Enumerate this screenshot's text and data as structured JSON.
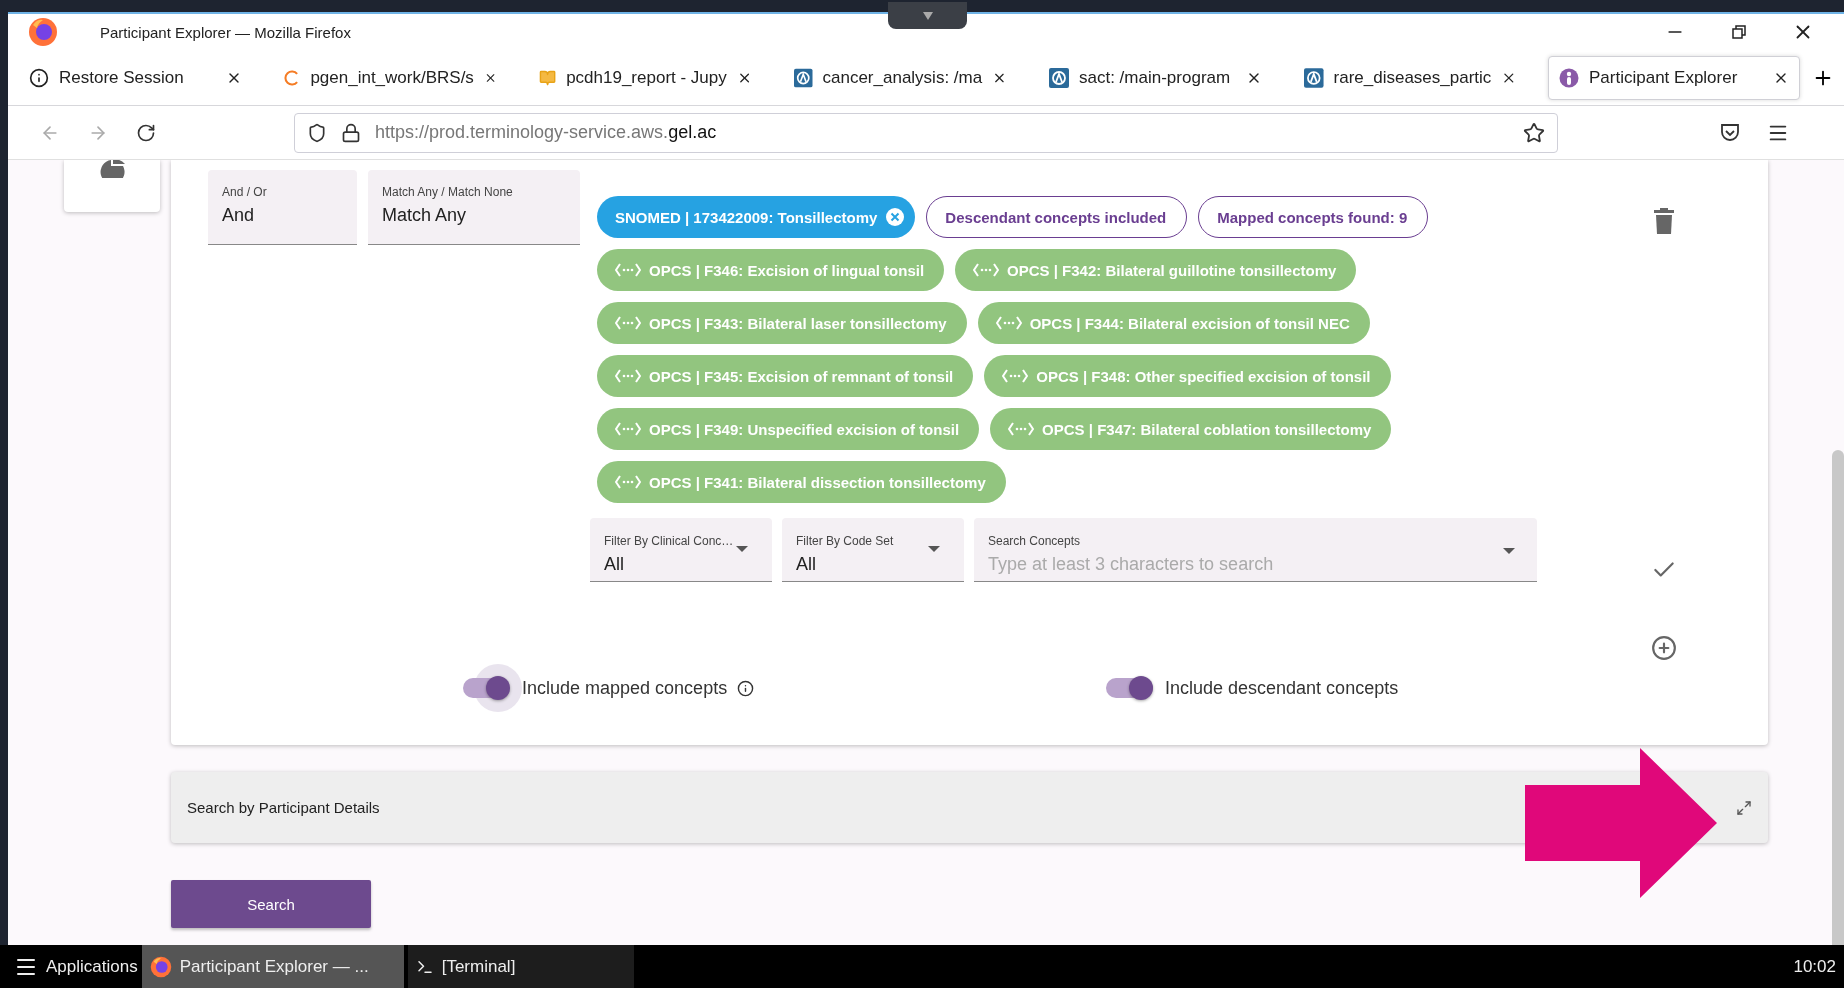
{
  "window": {
    "title": "Participant Explorer — Mozilla Firefox"
  },
  "tabs": [
    {
      "label": "Restore Session",
      "selected": false,
      "kind": "info"
    },
    {
      "label": "pgen_int_work/BRS/s",
      "selected": false,
      "kind": "loading"
    },
    {
      "label": "pcdh19_report - Jupy",
      "selected": false,
      "kind": "notebook"
    },
    {
      "label": "cancer_analysis: /ma",
      "selected": false,
      "kind": "app"
    },
    {
      "label": "sact: /main-program",
      "selected": false,
      "kind": "app"
    },
    {
      "label": "rare_diseases_partic",
      "selected": false,
      "kind": "app"
    },
    {
      "label": "Participant Explorer",
      "selected": true,
      "kind": "explorer"
    }
  ],
  "address_bar": {
    "url_base": "https://prod.terminology-service.aws.",
    "url_domain": "gel.ac"
  },
  "criterion": {
    "and_or": {
      "label": "And / Or",
      "value": "And"
    },
    "match": {
      "label": "Match Any / Match None",
      "value": "Match Any"
    },
    "selected_concept": "SNOMED | 173422009: Tonsillectomy",
    "tags": [
      "Descendant concepts included",
      "Mapped concepts found: 9"
    ],
    "mapped_rows": [
      [
        "OPCS | F346: Excision of lingual tonsil",
        "OPCS | F342: Bilateral guillotine tonsillectomy"
      ],
      [
        "OPCS | F343: Bilateral laser tonsillectomy",
        "OPCS | F344: Bilateral excision of tonsil NEC"
      ],
      [
        "OPCS | F345: Excision of remnant of tonsil",
        "OPCS | F348: Other specified excision of tonsil"
      ],
      [
        "OPCS | F349: Unspecified excision of tonsil",
        "OPCS | F347: Bilateral coblation tonsillectomy"
      ],
      [
        "OPCS | F341: Bilateral dissection tonsillectomy"
      ]
    ],
    "filters": [
      {
        "label": "Filter By Clinical Conc…",
        "value": "All"
      },
      {
        "label": "Filter By Code Set",
        "value": "All"
      }
    ],
    "search": {
      "label": "Search Concepts",
      "placeholder": "Type at least 3 characters to search"
    },
    "toggles": [
      {
        "label": "Include mapped concepts",
        "on": true,
        "focused": true,
        "has_info": true
      },
      {
        "label": "Include descendant concepts",
        "on": true,
        "focused": false,
        "has_info": false
      }
    ]
  },
  "accordion": {
    "title": "Search by Participant Details",
    "expanded": false
  },
  "search_button": "Search",
  "taskbar": {
    "start": "Applications",
    "tasks": [
      {
        "label": "Participant Explorer — ...",
        "selected": true,
        "kind": "firefox"
      },
      {
        "label": "[Terminal]",
        "selected": false,
        "kind": "terminal"
      }
    ],
    "clock": "10:02"
  }
}
